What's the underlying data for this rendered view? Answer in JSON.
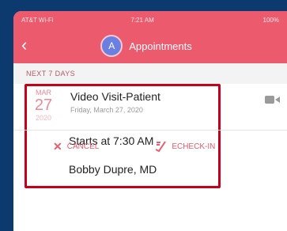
{
  "status_bar": {
    "carrier": "AT&T Wi-Fi",
    "time": "7:21 AM",
    "battery": "100%"
  },
  "nav": {
    "back_icon": "chevron-left-icon",
    "avatar_letter": "A",
    "title": "Appointments"
  },
  "section": {
    "header": "NEXT 7 DAYS"
  },
  "appointment": {
    "month": "MAR",
    "day": "27",
    "year": "2020",
    "title": "Video Visit-Patient",
    "date_full": "Friday, March 27, 2020",
    "starts": "Starts at 7:30 AM",
    "provider": "Bobby Dupre, MD"
  },
  "actions": {
    "cancel_label": "CANCEL",
    "echeckin_label": "ECHECK-IN"
  },
  "colors": {
    "brand": "#ec5a6e",
    "highlight": "#c4001a",
    "background": "#0d3a6e"
  }
}
